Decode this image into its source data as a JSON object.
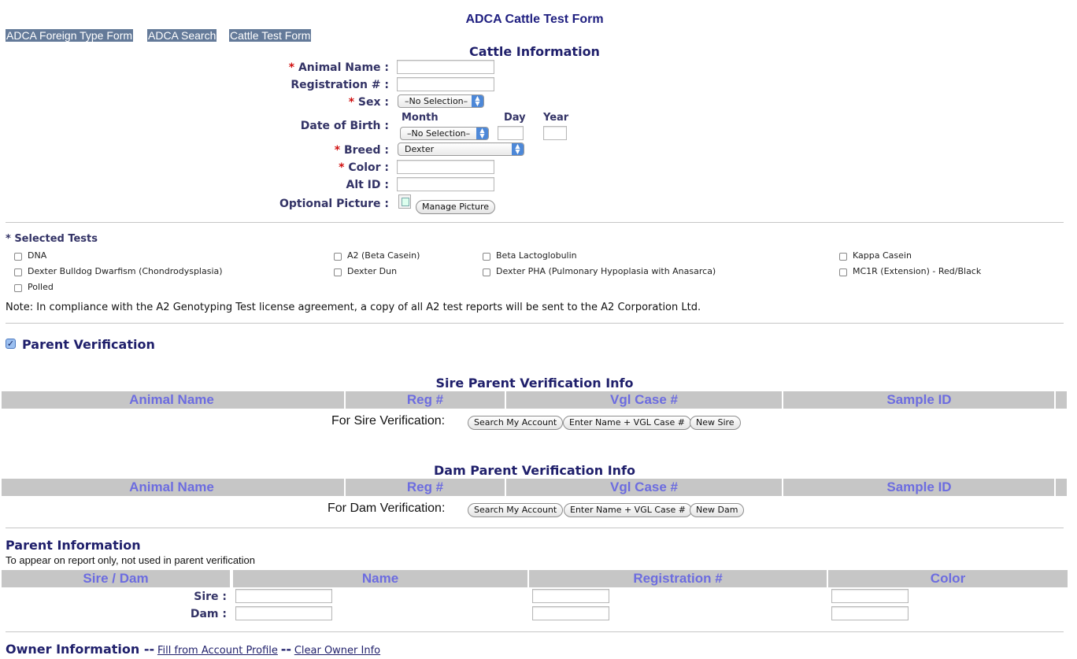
{
  "page": {
    "title": "ADCA Cattle Test Form"
  },
  "nav": [
    {
      "label": "ADCA Foreign Type Form"
    },
    {
      "label": "ADCA Search"
    },
    {
      "label": "Cattle Test Form"
    }
  ],
  "cattle": {
    "section_title": "Cattle Information",
    "required_mark": "*",
    "animal_name_label": "Animal Name :",
    "registration_label": "Registration # :",
    "sex_label": "Sex :",
    "sex_value": "–No Selection–",
    "dob_label": "Date of Birth :",
    "dob_month_label": "Month",
    "dob_day_label": "Day",
    "dob_year_label": "Year",
    "dob_month_value": "–No Selection–",
    "breed_label": "Breed :",
    "breed_value": "Dexter",
    "color_label": "Color :",
    "altid_label": "Alt ID :",
    "picture_label": "Optional Picture :",
    "manage_picture_button": "Manage Picture"
  },
  "tests": {
    "title": "* Selected Tests",
    "items": [
      {
        "label": "DNA"
      },
      {
        "label": "A2 (Beta Casein)"
      },
      {
        "label": "Beta Lactoglobulin"
      },
      {
        "label": "Kappa Casein"
      },
      {
        "label": "Dexter Bulldog Dwarfism (Chondrodysplasia)"
      },
      {
        "label": "Dexter Dun"
      },
      {
        "label": "Dexter PHA (Pulmonary Hypoplasia with Anasarca)"
      },
      {
        "label": "MC1R (Extension) - Red/Black"
      },
      {
        "label": "Polled"
      }
    ],
    "note": "Note: In compliance with the A2 Genotyping Test license agreement, a copy of all A2 test reports will be sent to the A2 Corporation Ltd."
  },
  "parent_verification": {
    "label": "Parent Verification",
    "checked": true,
    "columns": [
      "Animal Name",
      "Reg #",
      "Vgl Case #",
      "Sample ID"
    ],
    "sire": {
      "title": "Sire Parent Verification Info",
      "prompt": "For Sire Verification:",
      "search_button": "Search My Account",
      "enter_button": "Enter Name + VGL Case #",
      "new_button": "New Sire"
    },
    "dam": {
      "title": "Dam Parent Verification Info",
      "prompt": "For Dam Verification:",
      "search_button": "Search My Account",
      "enter_button": "Enter Name + VGL Case #",
      "new_button": "New Dam"
    }
  },
  "parent_info": {
    "title": "Parent Information",
    "subtitle": "To appear on report only, not used in parent verification",
    "columns": [
      "Sire / Dam",
      "Name",
      "Registration #",
      "Color"
    ],
    "sire_label": "Sire :",
    "dam_label": "Dam :"
  },
  "owner": {
    "title": "Owner Information --",
    "fill_link": "Fill from Account Profile",
    "separator": "--",
    "clear_link": "Clear Owner Info"
  }
}
